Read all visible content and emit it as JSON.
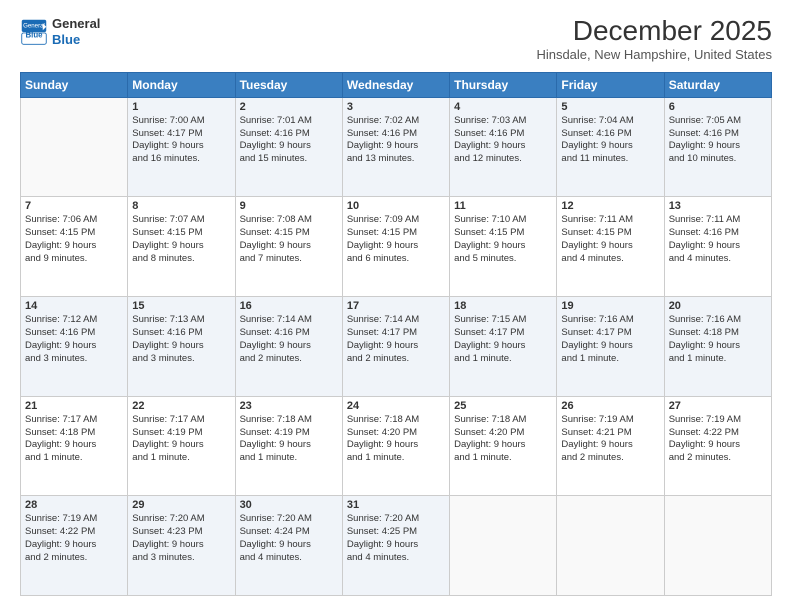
{
  "logo": {
    "line1": "General",
    "line2": "Blue"
  },
  "title": "December 2025",
  "subtitle": "Hinsdale, New Hampshire, United States",
  "days_of_week": [
    "Sunday",
    "Monday",
    "Tuesday",
    "Wednesday",
    "Thursday",
    "Friday",
    "Saturday"
  ],
  "weeks": [
    [
      {
        "day": "",
        "info": ""
      },
      {
        "day": "1",
        "info": "Sunrise: 7:00 AM\nSunset: 4:17 PM\nDaylight: 9 hours\nand 16 minutes."
      },
      {
        "day": "2",
        "info": "Sunrise: 7:01 AM\nSunset: 4:16 PM\nDaylight: 9 hours\nand 15 minutes."
      },
      {
        "day": "3",
        "info": "Sunrise: 7:02 AM\nSunset: 4:16 PM\nDaylight: 9 hours\nand 13 minutes."
      },
      {
        "day": "4",
        "info": "Sunrise: 7:03 AM\nSunset: 4:16 PM\nDaylight: 9 hours\nand 12 minutes."
      },
      {
        "day": "5",
        "info": "Sunrise: 7:04 AM\nSunset: 4:16 PM\nDaylight: 9 hours\nand 11 minutes."
      },
      {
        "day": "6",
        "info": "Sunrise: 7:05 AM\nSunset: 4:16 PM\nDaylight: 9 hours\nand 10 minutes."
      }
    ],
    [
      {
        "day": "7",
        "info": "Sunrise: 7:06 AM\nSunset: 4:15 PM\nDaylight: 9 hours\nand 9 minutes."
      },
      {
        "day": "8",
        "info": "Sunrise: 7:07 AM\nSunset: 4:15 PM\nDaylight: 9 hours\nand 8 minutes."
      },
      {
        "day": "9",
        "info": "Sunrise: 7:08 AM\nSunset: 4:15 PM\nDaylight: 9 hours\nand 7 minutes."
      },
      {
        "day": "10",
        "info": "Sunrise: 7:09 AM\nSunset: 4:15 PM\nDaylight: 9 hours\nand 6 minutes."
      },
      {
        "day": "11",
        "info": "Sunrise: 7:10 AM\nSunset: 4:15 PM\nDaylight: 9 hours\nand 5 minutes."
      },
      {
        "day": "12",
        "info": "Sunrise: 7:11 AM\nSunset: 4:15 PM\nDaylight: 9 hours\nand 4 minutes."
      },
      {
        "day": "13",
        "info": "Sunrise: 7:11 AM\nSunset: 4:16 PM\nDaylight: 9 hours\nand 4 minutes."
      }
    ],
    [
      {
        "day": "14",
        "info": "Sunrise: 7:12 AM\nSunset: 4:16 PM\nDaylight: 9 hours\nand 3 minutes."
      },
      {
        "day": "15",
        "info": "Sunrise: 7:13 AM\nSunset: 4:16 PM\nDaylight: 9 hours\nand 3 minutes."
      },
      {
        "day": "16",
        "info": "Sunrise: 7:14 AM\nSunset: 4:16 PM\nDaylight: 9 hours\nand 2 minutes."
      },
      {
        "day": "17",
        "info": "Sunrise: 7:14 AM\nSunset: 4:17 PM\nDaylight: 9 hours\nand 2 minutes."
      },
      {
        "day": "18",
        "info": "Sunrise: 7:15 AM\nSunset: 4:17 PM\nDaylight: 9 hours\nand 1 minute."
      },
      {
        "day": "19",
        "info": "Sunrise: 7:16 AM\nSunset: 4:17 PM\nDaylight: 9 hours\nand 1 minute."
      },
      {
        "day": "20",
        "info": "Sunrise: 7:16 AM\nSunset: 4:18 PM\nDaylight: 9 hours\nand 1 minute."
      }
    ],
    [
      {
        "day": "21",
        "info": "Sunrise: 7:17 AM\nSunset: 4:18 PM\nDaylight: 9 hours\nand 1 minute."
      },
      {
        "day": "22",
        "info": "Sunrise: 7:17 AM\nSunset: 4:19 PM\nDaylight: 9 hours\nand 1 minute."
      },
      {
        "day": "23",
        "info": "Sunrise: 7:18 AM\nSunset: 4:19 PM\nDaylight: 9 hours\nand 1 minute."
      },
      {
        "day": "24",
        "info": "Sunrise: 7:18 AM\nSunset: 4:20 PM\nDaylight: 9 hours\nand 1 minute."
      },
      {
        "day": "25",
        "info": "Sunrise: 7:18 AM\nSunset: 4:20 PM\nDaylight: 9 hours\nand 1 minute."
      },
      {
        "day": "26",
        "info": "Sunrise: 7:19 AM\nSunset: 4:21 PM\nDaylight: 9 hours\nand 2 minutes."
      },
      {
        "day": "27",
        "info": "Sunrise: 7:19 AM\nSunset: 4:22 PM\nDaylight: 9 hours\nand 2 minutes."
      }
    ],
    [
      {
        "day": "28",
        "info": "Sunrise: 7:19 AM\nSunset: 4:22 PM\nDaylight: 9 hours\nand 2 minutes."
      },
      {
        "day": "29",
        "info": "Sunrise: 7:20 AM\nSunset: 4:23 PM\nDaylight: 9 hours\nand 3 minutes."
      },
      {
        "day": "30",
        "info": "Sunrise: 7:20 AM\nSunset: 4:24 PM\nDaylight: 9 hours\nand 4 minutes."
      },
      {
        "day": "31",
        "info": "Sunrise: 7:20 AM\nSunset: 4:25 PM\nDaylight: 9 hours\nand 4 minutes."
      },
      {
        "day": "",
        "info": ""
      },
      {
        "day": "",
        "info": ""
      },
      {
        "day": "",
        "info": ""
      }
    ]
  ]
}
